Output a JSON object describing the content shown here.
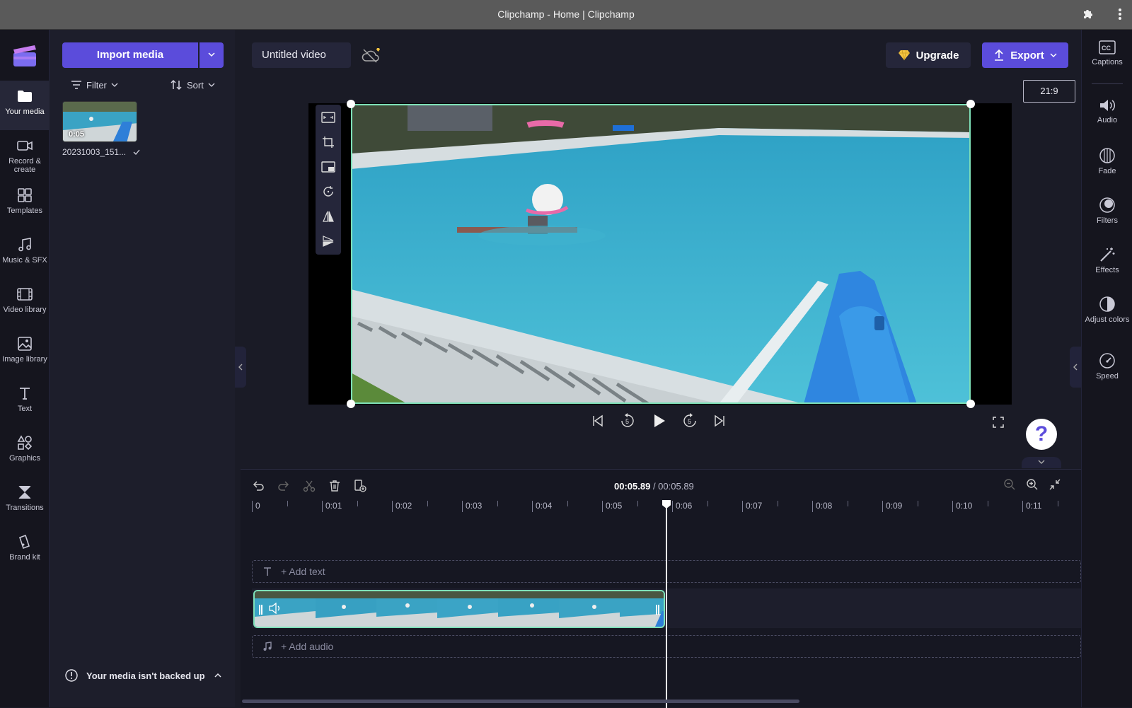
{
  "window": {
    "title": "Clipchamp - Home | Clipchamp"
  },
  "nav": [
    {
      "label": "Your media",
      "icon": "folder-icon",
      "active": true
    },
    {
      "label": "Record & create",
      "icon": "camera-icon"
    },
    {
      "label": "Templates",
      "icon": "templates-icon"
    },
    {
      "label": "Music & SFX",
      "icon": "music-icon"
    },
    {
      "label": "Video library",
      "icon": "film-icon"
    },
    {
      "label": "Image library",
      "icon": "image-icon"
    },
    {
      "label": "Text",
      "icon": "text-icon"
    },
    {
      "label": "Graphics",
      "icon": "shapes-icon"
    },
    {
      "label": "Transitions",
      "icon": "transitions-icon"
    },
    {
      "label": "Brand kit",
      "icon": "brand-kit-icon"
    }
  ],
  "media": {
    "import_label": "Import media",
    "filter_label": "Filter",
    "sort_label": "Sort",
    "items": [
      {
        "name": "20231003_151...",
        "duration": "0:05"
      }
    ],
    "backup_text": "Your media isn't backed up"
  },
  "project": {
    "title": "Untitled video",
    "upgrade_label": "Upgrade",
    "export_label": "Export",
    "aspect_ratio": "21:9"
  },
  "right_panel": [
    {
      "label": "Captions",
      "icon": "captions-icon"
    },
    {
      "label": "Audio",
      "icon": "speaker-icon"
    },
    {
      "label": "Fade",
      "icon": "fade-icon"
    },
    {
      "label": "Filters",
      "icon": "filters-icon"
    },
    {
      "label": "Effects",
      "icon": "effects-wand-icon"
    },
    {
      "label": "Adjust colors",
      "icon": "adjust-colors-icon"
    },
    {
      "label": "Speed",
      "icon": "speed-gauge-icon"
    }
  ],
  "timeline": {
    "current_time": "00:05.89",
    "separator": " / ",
    "total_time": "00:05.89",
    "ruler": [
      "0",
      "0:01",
      "0:02",
      "0:03",
      "0:04",
      "0:05",
      "0:06",
      "0:07",
      "0:08",
      "0:09",
      "0:10",
      "0:11"
    ],
    "add_text_label": "+ Add text",
    "add_audio_label": "+ Add audio"
  },
  "help": {
    "label": "?"
  },
  "colors": {
    "accent": "#5b4cdb",
    "selection": "#7ee0b8",
    "background": "#1a1b26"
  }
}
